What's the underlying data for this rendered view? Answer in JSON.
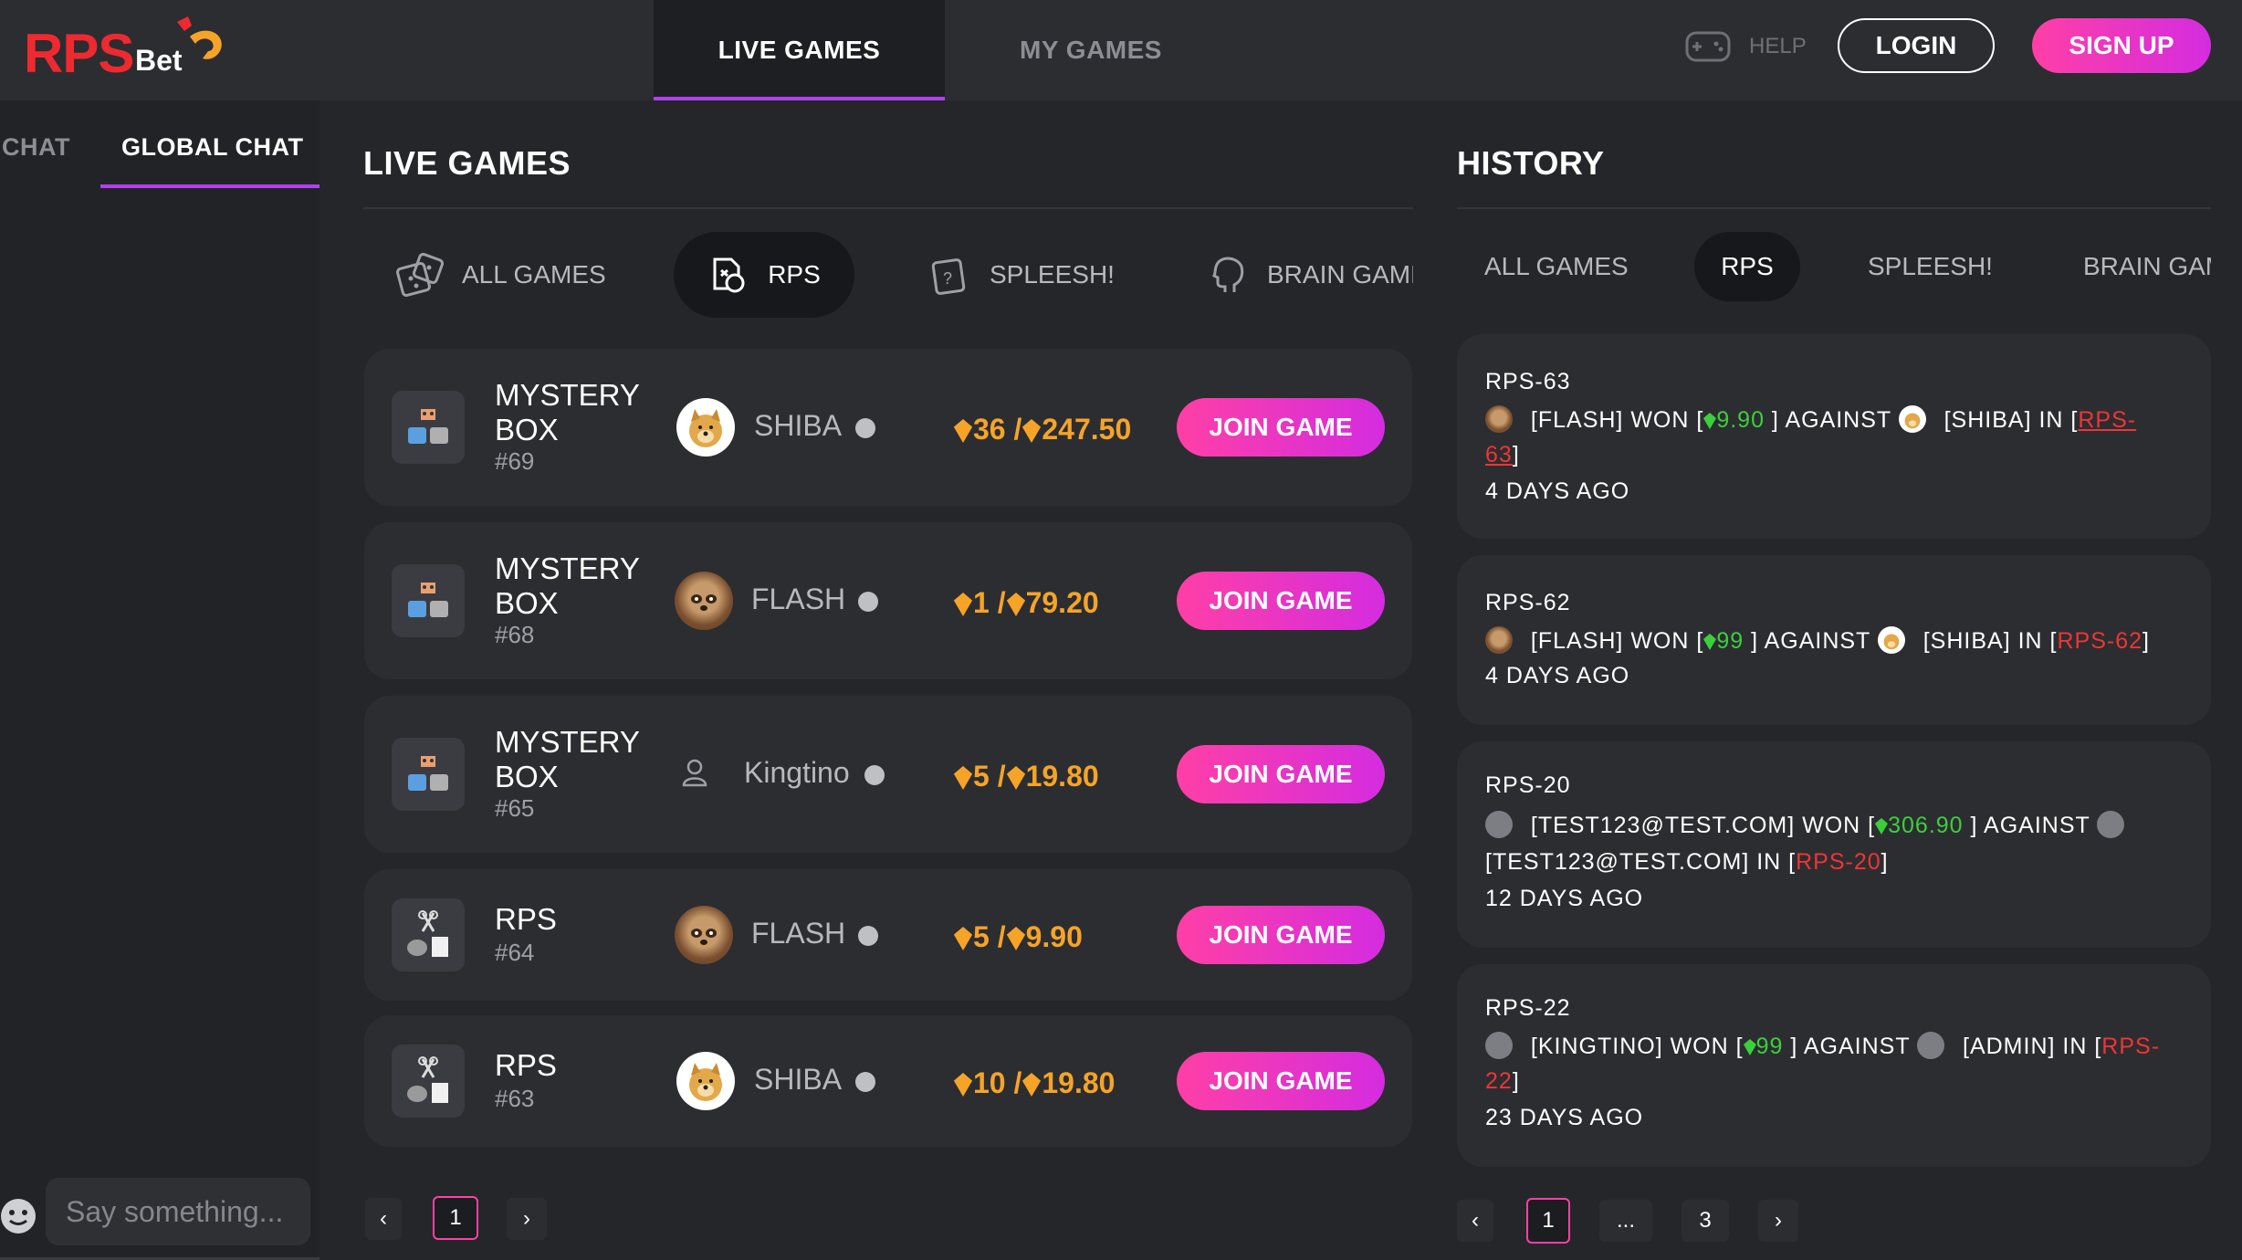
{
  "colors": {
    "accent": "#b23ff0",
    "brand_red": "#ee2a30",
    "gold": "#f5a428",
    "pink": "#ff3fa6",
    "win_green": "#3ccf3c"
  },
  "header": {
    "logo_rps": "RPS",
    "logo_bet": "Bet",
    "tabs": [
      {
        "label": "LIVE GAMES"
      },
      {
        "label": "MY GAMES"
      }
    ],
    "help_label": "HELP",
    "login_label": "LOGIN",
    "signup_label": "SIGN UP"
  },
  "chat": {
    "tabs": [
      {
        "label": "CHAT"
      },
      {
        "label": "GLOBAL CHAT"
      }
    ],
    "input_placeholder": "Say something..."
  },
  "live_games": {
    "title": "LIVE GAMES",
    "filters": [
      {
        "label": "ALL GAMES"
      },
      {
        "label": "RPS"
      },
      {
        "label": "SPLEESH!"
      },
      {
        "label": "BRAIN GAME"
      }
    ],
    "games": [
      {
        "name_line1": "MYSTERY",
        "name_line2": "BOX",
        "number": "#69",
        "player": "SHIBA",
        "avatar": "doge-icon",
        "amount": "36 /",
        "total": "247.50",
        "join": "JOIN GAME"
      },
      {
        "name_line1": "MYSTERY",
        "name_line2": "BOX",
        "number": "#68",
        "player": "FLASH",
        "avatar": "sloth-icon",
        "amount": "1 /",
        "total": "79.20",
        "join": "JOIN GAME"
      },
      {
        "name_line1": "MYSTERY",
        "name_line2": "BOX",
        "number": "#65",
        "player": "Kingtino",
        "avatar": "user-outline-icon",
        "amount": "5 /",
        "total": "19.80",
        "join": "JOIN GAME"
      },
      {
        "name_line1": "RPS",
        "name_line2": "",
        "number": "#64",
        "player": "FLASH",
        "avatar": "sloth-icon",
        "amount": "5 /",
        "total": "9.90",
        "join": "JOIN GAME"
      },
      {
        "name_line1": "RPS",
        "name_line2": "",
        "number": "#63",
        "player": "SHIBA",
        "avatar": "doge-icon",
        "amount": "10 /",
        "total": "19.80",
        "join": "JOIN GAME"
      }
    ],
    "pagination": {
      "prev": "‹",
      "current": "1",
      "next": "›"
    }
  },
  "history": {
    "title": "HISTORY",
    "filters": [
      {
        "label": "ALL GAMES"
      },
      {
        "label": "RPS"
      },
      {
        "label": "SPLEESH!"
      },
      {
        "label": "BRAIN GAME"
      }
    ],
    "entries": [
      {
        "id": "RPS-63",
        "winner": "[FLASH] WON [",
        "amount": "9.90",
        "against": " ] AGAINST ",
        "loser": "[SHIBA] IN [",
        "link_a": "RPS-",
        "link_b": "63",
        "close": "]",
        "time": "4 DAYS AGO"
      },
      {
        "id": "RPS-62",
        "winner": "[FLASH] WON [",
        "amount": "99",
        "against": " ] AGAINST ",
        "loser": "[SHIBA] IN [",
        "link": "RPS-62",
        "close": "]",
        "time": "4 DAYS AGO"
      },
      {
        "id": "RPS-20",
        "winner": "[TEST123@TEST.COM] WON [",
        "amount": "306.90",
        "against": " ] AGAINST ",
        "loser": "[TEST123@TEST.COM] IN [",
        "link": "RPS-20",
        "close": "]",
        "time": "12 DAYS AGO"
      },
      {
        "id": "RPS-22",
        "winner": "[KINGTINO] WON [",
        "amount": "99",
        "against": " ] AGAINST ",
        "loser": "[ADMIN] IN [",
        "link_a": "RPS-",
        "link_b": "22",
        "close": "]",
        "time": "23 DAYS AGO"
      }
    ],
    "pagination": {
      "prev": "‹",
      "current": "1",
      "ellipsis": "...",
      "last": "3",
      "next": "›"
    }
  }
}
